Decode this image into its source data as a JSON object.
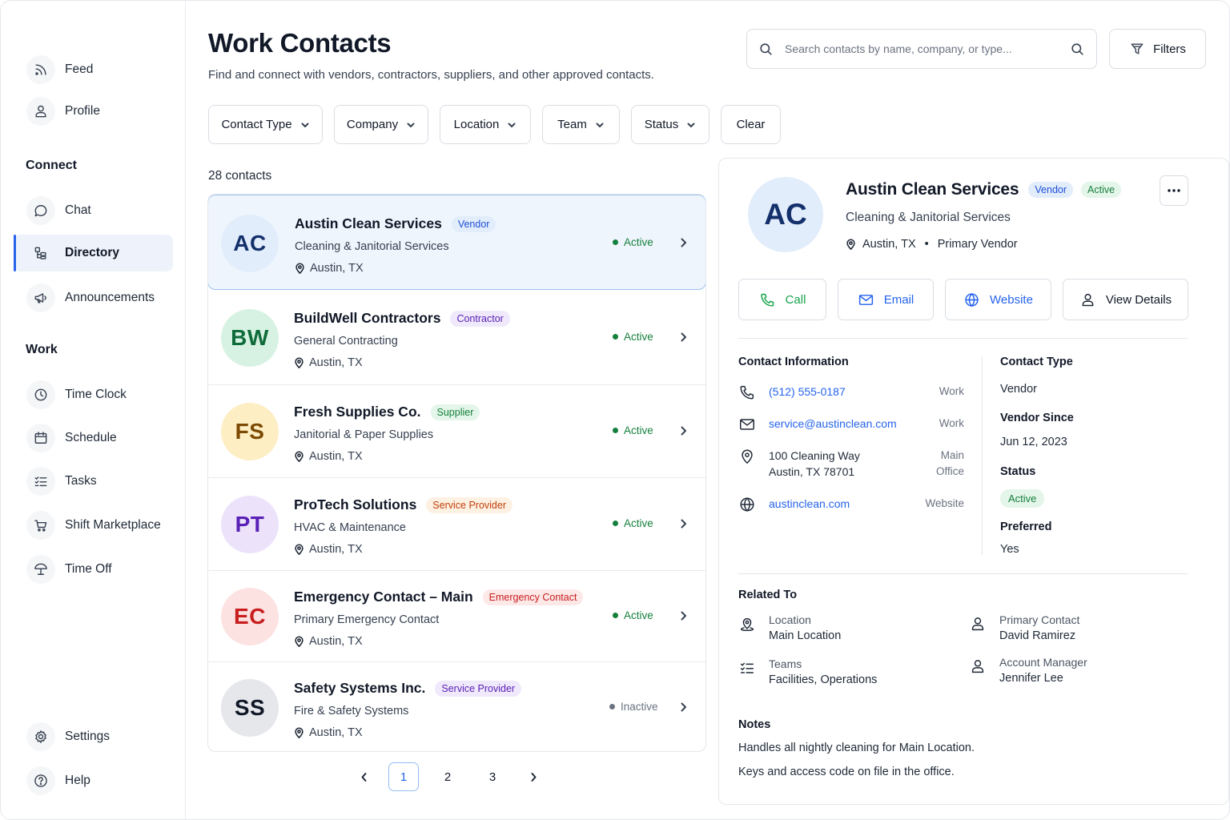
{
  "sidebar": {
    "items_top": [
      {
        "label": "Feed",
        "icon": "rss-icon"
      },
      {
        "label": "Profile",
        "icon": "user-icon"
      }
    ],
    "section_connect": "Connect",
    "items_connect": [
      {
        "label": "Chat",
        "icon": "chat-bubble-icon"
      },
      {
        "label": "Directory",
        "icon": "directory-icon",
        "active": true
      },
      {
        "label": "Announcements",
        "icon": "megaphone-icon"
      }
    ],
    "section_work": "Work",
    "items_work": [
      {
        "label": "Time Clock",
        "icon": "clock-icon"
      },
      {
        "label": "Schedule",
        "icon": "calendar-icon"
      },
      {
        "label": "Tasks",
        "icon": "checklist-icon"
      },
      {
        "label": "Shift Marketplace",
        "icon": "cart-icon"
      },
      {
        "label": "Time Off",
        "icon": "umbrella-icon"
      }
    ],
    "items_bottom": [
      {
        "label": "Settings",
        "icon": "gear-icon"
      },
      {
        "label": "Help",
        "icon": "help-icon"
      }
    ]
  },
  "header": {
    "title": "Work Contacts",
    "subtitle": "Find and connect with vendors, contractors, suppliers, and other approved contacts.",
    "search_placeholder": "Search contacts by name, company, or type...",
    "filters_label": "Filters"
  },
  "filters": {
    "chips": [
      "Contact Type",
      "Company",
      "Location",
      "Team",
      "Status"
    ],
    "clear_label": "Clear"
  },
  "list": {
    "count": "28 contacts",
    "contacts": [
      {
        "initials": "AC",
        "name": "Austin Clean Services",
        "type": "Vendor",
        "category": "Cleaning & Janitorial Services",
        "location": "Austin, TX",
        "status": "Active",
        "avatar_bg": "#e2edfb",
        "avatar_fg": "#13306b",
        "badge_bg": "#e2edfb",
        "badge_fg": "#1d4ed8"
      },
      {
        "initials": "BW",
        "name": "BuildWell Contractors",
        "type": "Contractor",
        "category": "General Contracting",
        "location": "Austin, TX",
        "status": "Active",
        "avatar_bg": "#d7f2e2",
        "avatar_fg": "#0f6b3a",
        "badge_bg": "#efe9fb",
        "badge_fg": "#5b21b6"
      },
      {
        "initials": "FS",
        "name": "Fresh Supplies Co.",
        "type": "Supplier",
        "category": "Janitorial & Paper Supplies",
        "location": "Austin, TX",
        "status": "Active",
        "avatar_bg": "#fdeec4",
        "avatar_fg": "#7c4a03",
        "badge_bg": "#e4f5e9",
        "badge_fg": "#15803d"
      },
      {
        "initials": "PT",
        "name": "ProTech Solutions",
        "type": "Service Provider",
        "category": "HVAC & Maintenance",
        "location": "Austin, TX",
        "status": "Active",
        "avatar_bg": "#ece3fb",
        "avatar_fg": "#5b21b6",
        "badge_bg": "#fdf1e3",
        "badge_fg": "#c2410c"
      },
      {
        "initials": "EC",
        "name": "Emergency Contact – Main",
        "type": "Emergency Contact",
        "category": "Primary Emergency Contact",
        "location": "Austin, TX",
        "status": "Active",
        "avatar_bg": "#fde2e2",
        "avatar_fg": "#c81e1e",
        "badge_bg": "#fde8e8",
        "badge_fg": "#c81e1e"
      },
      {
        "initials": "SS",
        "name": "Safety Systems Inc.",
        "type": "Service Provider",
        "category": "Fire & Safety Systems",
        "location": "Austin, TX",
        "status": "Inactive",
        "avatar_bg": "#e5e7eb",
        "avatar_fg": "#111827",
        "badge_bg": "#efe9fb",
        "badge_fg": "#5b21b6"
      }
    ]
  },
  "pagination": {
    "pages": [
      "1",
      "2",
      "3"
    ],
    "current": "1"
  },
  "detail": {
    "initials": "AC",
    "name": "Austin Clean Services",
    "type_badge": "Vendor",
    "status_badge": "Active",
    "category": "Cleaning & Janitorial Services",
    "location": "Austin, TX",
    "role": "Primary Vendor",
    "separator": "•",
    "actions": {
      "call": "Call",
      "email": "Email",
      "website": "Website",
      "view_details": "View Details"
    },
    "contact_info": {
      "title": "Contact Information",
      "phone": "(512) 555-0187",
      "phone_tag": "Work",
      "email": "service@austinclean.com",
      "email_tag": "Work",
      "address": "100 Cleaning Way\nAustin, TX 78701",
      "address_tag": "Main\nOffice",
      "website": "austinclean.com",
      "website_tag": "Website"
    },
    "meta": {
      "contact_type_label": "Contact Type",
      "contact_type": "Vendor",
      "vendor_since_label": "Vendor Since",
      "vendor_since": "Jun 12, 2023",
      "status_label": "Status",
      "status": "Active",
      "preferred_label": "Preferred",
      "preferred": "Yes"
    },
    "related": {
      "title": "Related To",
      "location_label": "Location",
      "location": "Main Location",
      "teams_label": "Teams",
      "teams": "Facilities, Operations",
      "primary_contact_label": "Primary Contact",
      "primary_contact": "David Ramirez",
      "account_manager_label": "Account Manager",
      "account_manager": "Jennifer Lee"
    },
    "notes": {
      "title": "Notes",
      "line1": "Handles all nightly cleaning for Main Location.",
      "line2": "Keys and access code on file in the office."
    }
  },
  "colors": {
    "accent": "#2563eb",
    "active_green": "#15803d",
    "inactive_gray": "#6b7280",
    "call_green": "#16a34a"
  }
}
